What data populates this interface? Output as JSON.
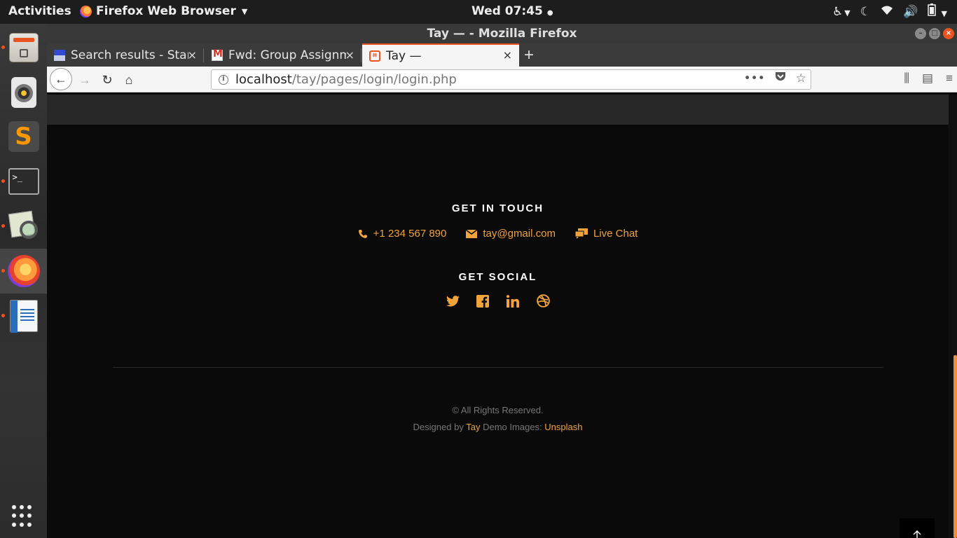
{
  "topbar": {
    "activities": "Activities",
    "app_name": "Firefox Web Browser",
    "clock": "Wed 07:45"
  },
  "window": {
    "title": "Tay — - Mozilla Firefox"
  },
  "tabs": [
    {
      "label": "Search results - Star",
      "close": "×"
    },
    {
      "label": "Fwd: Group Assignm",
      "close": "×"
    },
    {
      "label": "Tay —",
      "close": "×"
    }
  ],
  "url": {
    "host": "localhost",
    "path": "/tay/pages/login/login.php"
  },
  "footer": {
    "get_in_touch": "GET IN TOUCH",
    "phone": "+1 234 567 890",
    "email": "tay@gmail.com",
    "live_chat": "Live Chat",
    "get_social": "GET SOCIAL",
    "copyright": "© All Rights Reserved.",
    "designed_by": "Designed by",
    "designer": "Tay",
    "demo_images": "Demo Images:",
    "images_source": "Unsplash"
  },
  "colors": {
    "accent": "#f1a33c",
    "footer_bg": "#0a0a0a",
    "ubuntu_orange": "#e95420"
  },
  "icons": {
    "phone": "phone-icon",
    "email": "envelope-icon",
    "chat": "chat-icon",
    "twitter": "twitter-icon",
    "facebook": "facebook-icon",
    "linkedin": "linkedin-icon",
    "dribbble": "dribbble-icon",
    "to_top": "arrow-up-icon"
  }
}
